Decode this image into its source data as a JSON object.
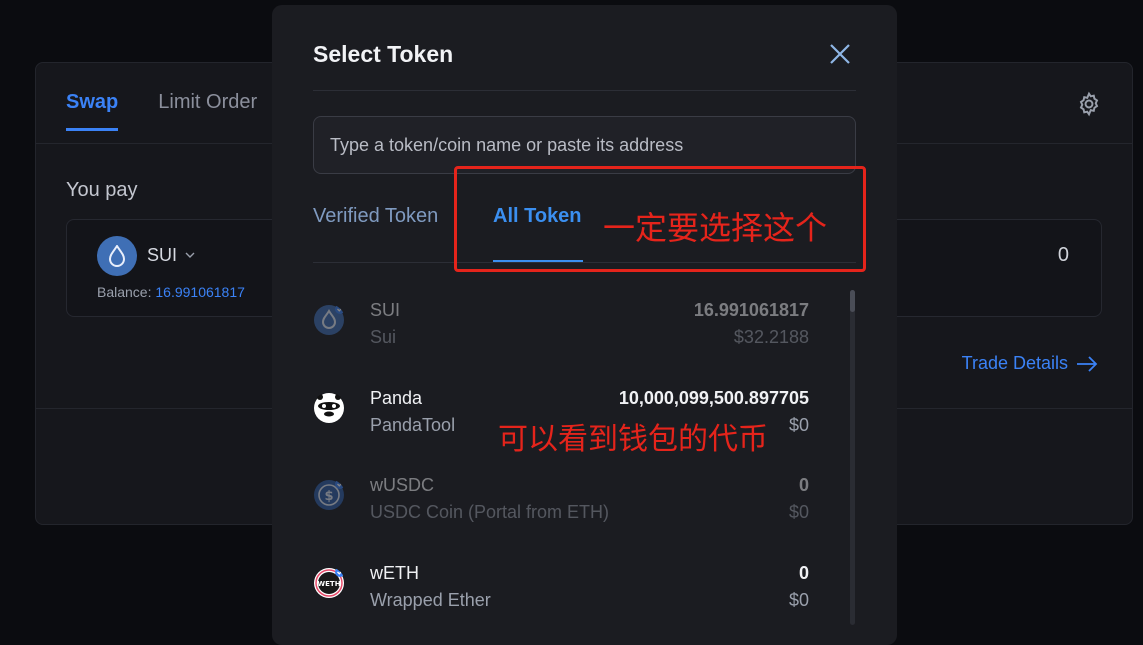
{
  "background": {
    "tabs": [
      "Swap",
      "Limit Order"
    ],
    "you_pay_label": "You pay",
    "pay_token_symbol": "SUI",
    "balance_label": "Balance:",
    "balance_value": "16.991061817",
    "amount": "0",
    "trade_details_label": "Trade Details"
  },
  "modal": {
    "title": "Select Token",
    "search_placeholder": "Type a token/coin name or paste its address",
    "tabs": {
      "verified": "Verified Token",
      "all": "All Token"
    },
    "tokens": [
      {
        "symbol": "SUI",
        "name": "Sui",
        "balance": "16.991061817",
        "usd": "$32.2188",
        "icon": "sui-icon"
      },
      {
        "symbol": "Panda",
        "name": "PandaTool",
        "balance": "10,000,099,500.897705",
        "usd": "$0",
        "icon": "panda-icon"
      },
      {
        "symbol": "wUSDC",
        "name": "USDC Coin (Portal from ETH)",
        "balance": "0",
        "usd": "$0",
        "icon": "usdc-icon"
      },
      {
        "symbol": "wETH",
        "name": "Wrapped Ether",
        "balance": "0",
        "usd": "$0",
        "icon": "weth-icon"
      }
    ]
  },
  "annotations": {
    "select_hint": "一定要选择这个",
    "wallet_hint": "可以看到钱包的代币"
  },
  "colors": {
    "accent": "#3b82f6",
    "annotation": "#e5241b"
  }
}
